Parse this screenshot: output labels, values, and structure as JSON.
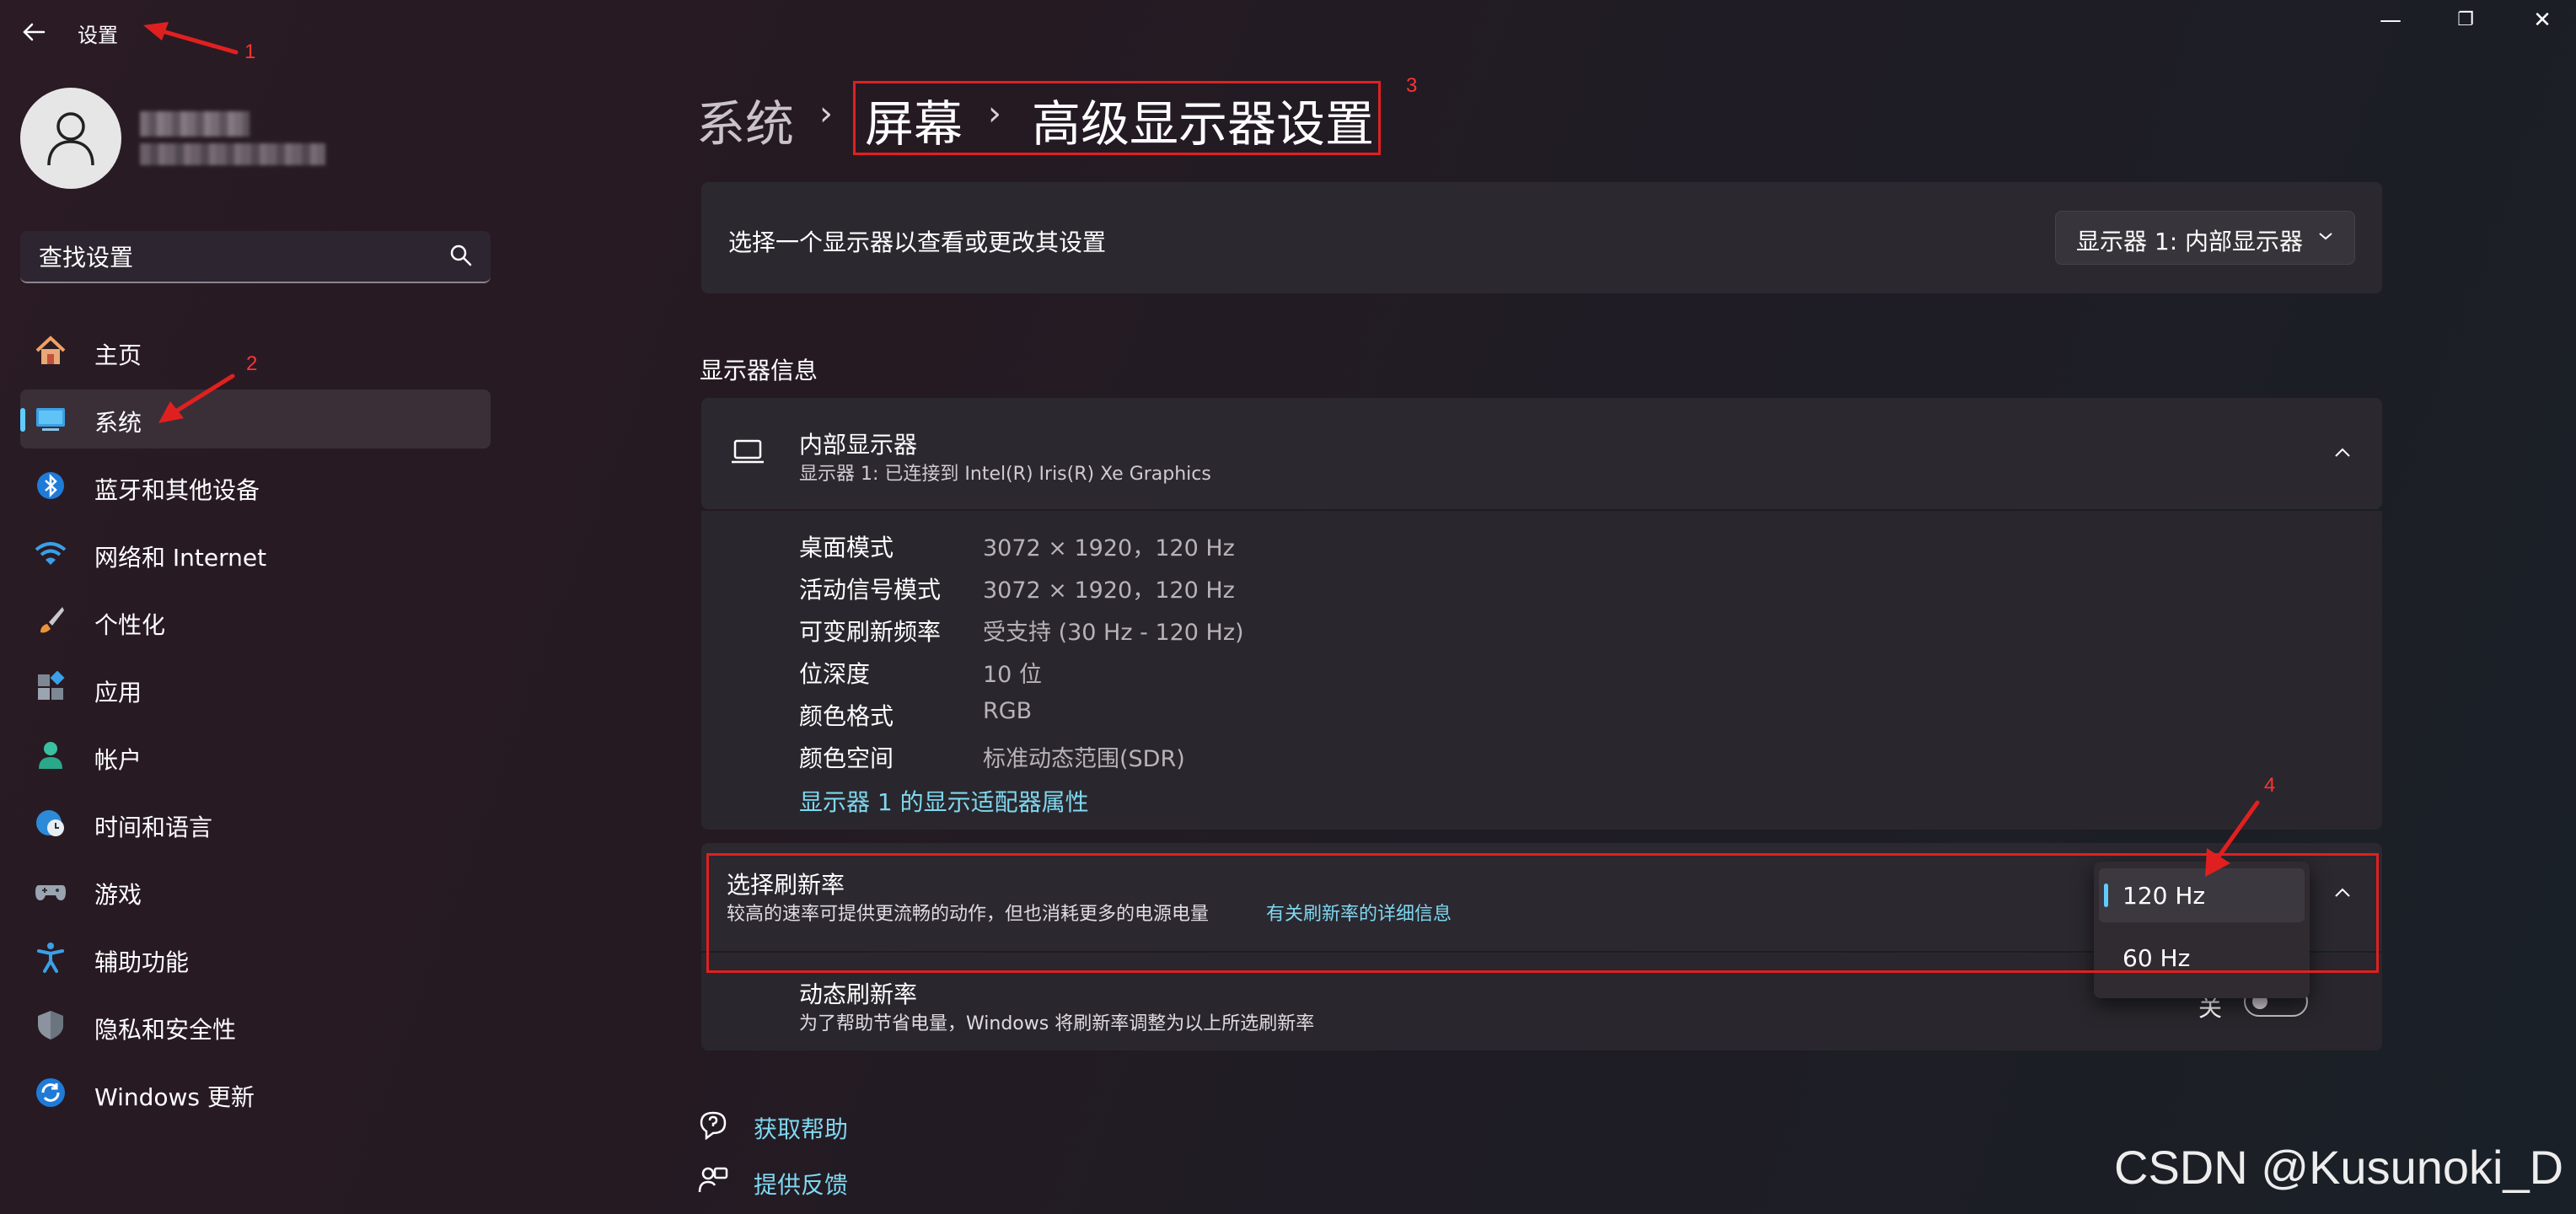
{
  "window": {
    "title": "设置",
    "minimize_glyph": "—",
    "restore_glyph": "❐",
    "close_glyph": "✕"
  },
  "search": {
    "placeholder": "查找设置"
  },
  "sidebar": {
    "items": [
      {
        "label": "主页",
        "icon": "home-icon",
        "active": false
      },
      {
        "label": "系统",
        "icon": "system-monitor-icon",
        "active": true
      },
      {
        "label": "蓝牙和其他设备",
        "icon": "bluetooth-icon",
        "active": false
      },
      {
        "label": "网络和 Internet",
        "icon": "wifi-icon",
        "active": false
      },
      {
        "label": "个性化",
        "icon": "brush-icon",
        "active": false
      },
      {
        "label": "应用",
        "icon": "apps-icon",
        "active": false
      },
      {
        "label": "帐户",
        "icon": "account-icon",
        "active": false
      },
      {
        "label": "时间和语言",
        "icon": "globe-clock-icon",
        "active": false
      },
      {
        "label": "游戏",
        "icon": "gamepad-icon",
        "active": false
      },
      {
        "label": "辅助功能",
        "icon": "accessibility-icon",
        "active": false
      },
      {
        "label": "隐私和安全性",
        "icon": "shield-icon",
        "active": false
      },
      {
        "label": "Windows 更新",
        "icon": "update-icon",
        "active": false
      }
    ]
  },
  "breadcrumb": {
    "items": [
      "系统",
      "屏幕",
      "高级显示器设置"
    ],
    "separator": "›"
  },
  "display_select": {
    "label": "选择一个显示器以查看或更改其设置",
    "value": "显示器 1: 内部显示器"
  },
  "display_info": {
    "section_title": "显示器信息",
    "name": "内部显示器",
    "subtitle": "显示器 1: 已连接到 Intel(R) Iris(R) Xe Graphics",
    "rows": [
      {
        "key": "桌面模式",
        "value": "3072 × 1920，120 Hz"
      },
      {
        "key": "活动信号模式",
        "value": "3072 × 1920，120 Hz"
      },
      {
        "key": "可变刷新频率",
        "value": "受支持 (30 Hz - 120 Hz)"
      },
      {
        "key": "位深度",
        "value": "10 位"
      },
      {
        "key": "颜色格式",
        "value": "RGB"
      },
      {
        "key": "颜色空间",
        "value": "标准动态范围(SDR)"
      }
    ],
    "adapter_link": "显示器 1 的显示适配器属性"
  },
  "refresh_rate": {
    "title": "选择刷新率",
    "description": "较高的速率可提供更流畅的动作，但也消耗更多的电源电量",
    "link": "有关刷新率的详细信息",
    "options": [
      {
        "label": "120 Hz",
        "selected": true
      },
      {
        "label": "60 Hz",
        "selected": false
      }
    ]
  },
  "dynamic_refresh": {
    "title": "动态刷新率",
    "description": "为了帮助节省电量，Windows 将刷新率调整为以上所选刷新率",
    "toggle_label": "关",
    "toggle_on": false
  },
  "footer_links": [
    {
      "label": "获取帮助",
      "icon": "help-icon"
    },
    {
      "label": "提供反馈",
      "icon": "feedback-icon"
    }
  ],
  "annotations": [
    "1",
    "2",
    "3",
    "4"
  ],
  "watermark": "CSDN @Kusunoki_D",
  "colors": {
    "accent": "#60cdff",
    "link": "#7fd8f0",
    "annotation_red": "#e02020"
  }
}
